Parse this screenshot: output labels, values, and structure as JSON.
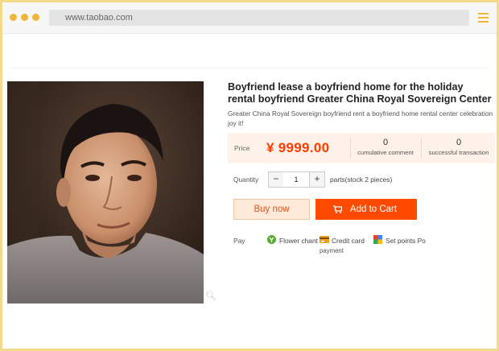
{
  "browser": {
    "url": "www.taobao.com"
  },
  "product": {
    "title": "Boyfriend lease a boyfriend home for the holiday rental boyfriend Greater China Royal Sovereign Center",
    "subtitle": "Greater China Royal Sovereign boyfriend rent a boyfriend home rental center celebration joy it!",
    "image_alt": "Photo of a young man"
  },
  "pricing": {
    "label": "Price",
    "value": "¥ 9999.00",
    "comments_count": "0",
    "comments_label": "cumulative comment",
    "transactions_count": "0",
    "transactions_label": "successful transaction"
  },
  "quantity": {
    "label": "Quantity",
    "value": "1",
    "minus": "−",
    "plus": "+",
    "stock_text": "parts(stock 2 pieces)"
  },
  "actions": {
    "buy_now": "Buy now",
    "add_to_cart": "Add to Cart"
  },
  "payment": {
    "label": "Pay",
    "methods": [
      {
        "icon": "flower-chant-icon",
        "label": "Flower chant"
      },
      {
        "icon": "credit-card-icon",
        "label": "Credit card",
        "sublabel": "payment"
      },
      {
        "icon": "set-points-icon",
        "label": "Set points Po"
      }
    ]
  },
  "colors": {
    "accent": "#ff4a00",
    "price": "#ff3c00",
    "frame": "#f3d98a"
  }
}
